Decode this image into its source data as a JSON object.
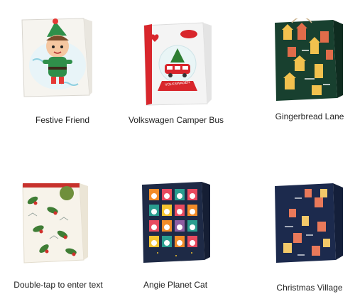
{
  "products": [
    {
      "id": "festive-friend",
      "label": "Festive Friend"
    },
    {
      "id": "vw-camper",
      "label": "Volkswagen Camper Bus",
      "tag_text": "VOLKSWAGEN"
    },
    {
      "id": "gingerbread",
      "label": "Gingerbread Lane"
    },
    {
      "id": "double-tap",
      "label": "Double-tap to enter text"
    },
    {
      "id": "planet-cat",
      "label": "Angie  Planet Cat"
    },
    {
      "id": "xmas-village",
      "label": "Christmas Village"
    }
  ],
  "colors": {
    "bag_white": "#f4f2ee",
    "vw_red": "#d8262c",
    "gingerbread_green": "#18402f",
    "village_navy": "#1c2a4d",
    "cat_navy": "#1e2a46"
  }
}
